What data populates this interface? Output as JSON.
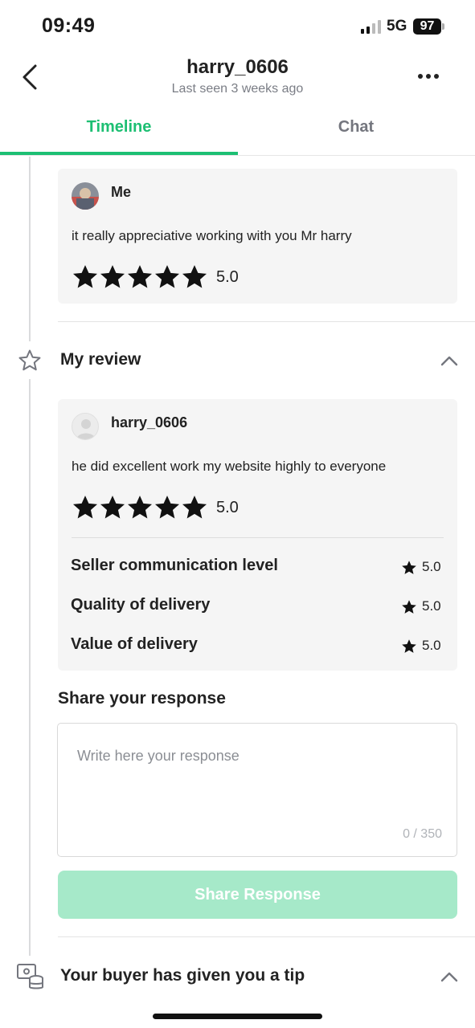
{
  "status_bar": {
    "time": "09:49",
    "network": "5G",
    "battery": "97"
  },
  "header": {
    "title": "harry_0606",
    "subtitle": "Last seen 3 weeks ago"
  },
  "tabs": [
    {
      "label": "Timeline",
      "active": true
    },
    {
      "label": "Chat",
      "active": false
    }
  ],
  "seller_review": {
    "reviewer": "Me",
    "text": "it really appreciative working with you Mr harry",
    "stars": 5,
    "rating": "5.0"
  },
  "my_review": {
    "section_title": "My review",
    "reviewer": "harry_0606",
    "text": "he did excellent work my website highly to everyone",
    "stars": 5,
    "rating": "5.0",
    "sub_ratings": [
      {
        "label": "Seller communication level",
        "value": "5.0"
      },
      {
        "label": "Quality of delivery",
        "value": "5.0"
      },
      {
        "label": "Value of delivery",
        "value": "5.0"
      }
    ]
  },
  "response": {
    "label": "Share your response",
    "placeholder": "Write here your response",
    "value": "",
    "counter": "0 / 350",
    "button_label": "Share Response"
  },
  "tip_section": {
    "title": "Your buyer has given you a tip"
  },
  "colors": {
    "accent": "#1dbf73",
    "button_disabled": "#a6e9c9",
    "card_bg": "#f5f5f5",
    "star": "#111111"
  },
  "icons": [
    "back-arrow-icon",
    "more-dots-icon",
    "star-outline-icon",
    "chevron-up-icon",
    "tip-money-icon",
    "star-icon"
  ]
}
